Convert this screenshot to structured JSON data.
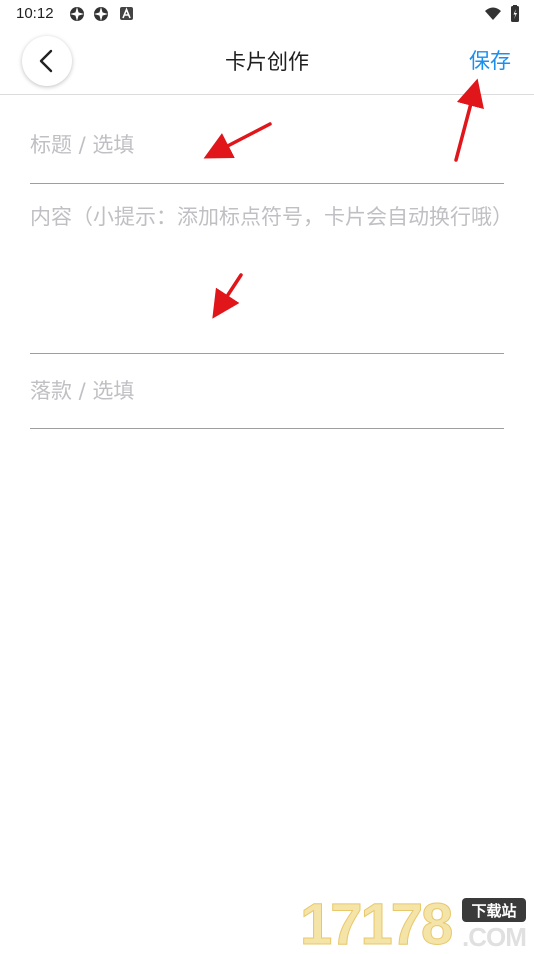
{
  "status_bar": {
    "time": "10:12",
    "icons": [
      "app-notification-icon",
      "app-notification-icon",
      "a-letter-icon",
      "wifi-icon",
      "battery-icon"
    ]
  },
  "header": {
    "back_icon": "chevron-left-icon",
    "title": "卡片创作",
    "save_label": "保存",
    "save_color": "#1a8ff0"
  },
  "form": {
    "title_placeholder": "标题 / 选填",
    "content_placeholder": "内容（小提示：添加标点符号，卡片会自动换行哦）",
    "signature_placeholder": "落款 / 选填"
  },
  "annotations": {
    "arrow_color": "#e0161b"
  },
  "watermark": {
    "number": "17178",
    "badge": "下载站",
    "domain": ".COM"
  }
}
